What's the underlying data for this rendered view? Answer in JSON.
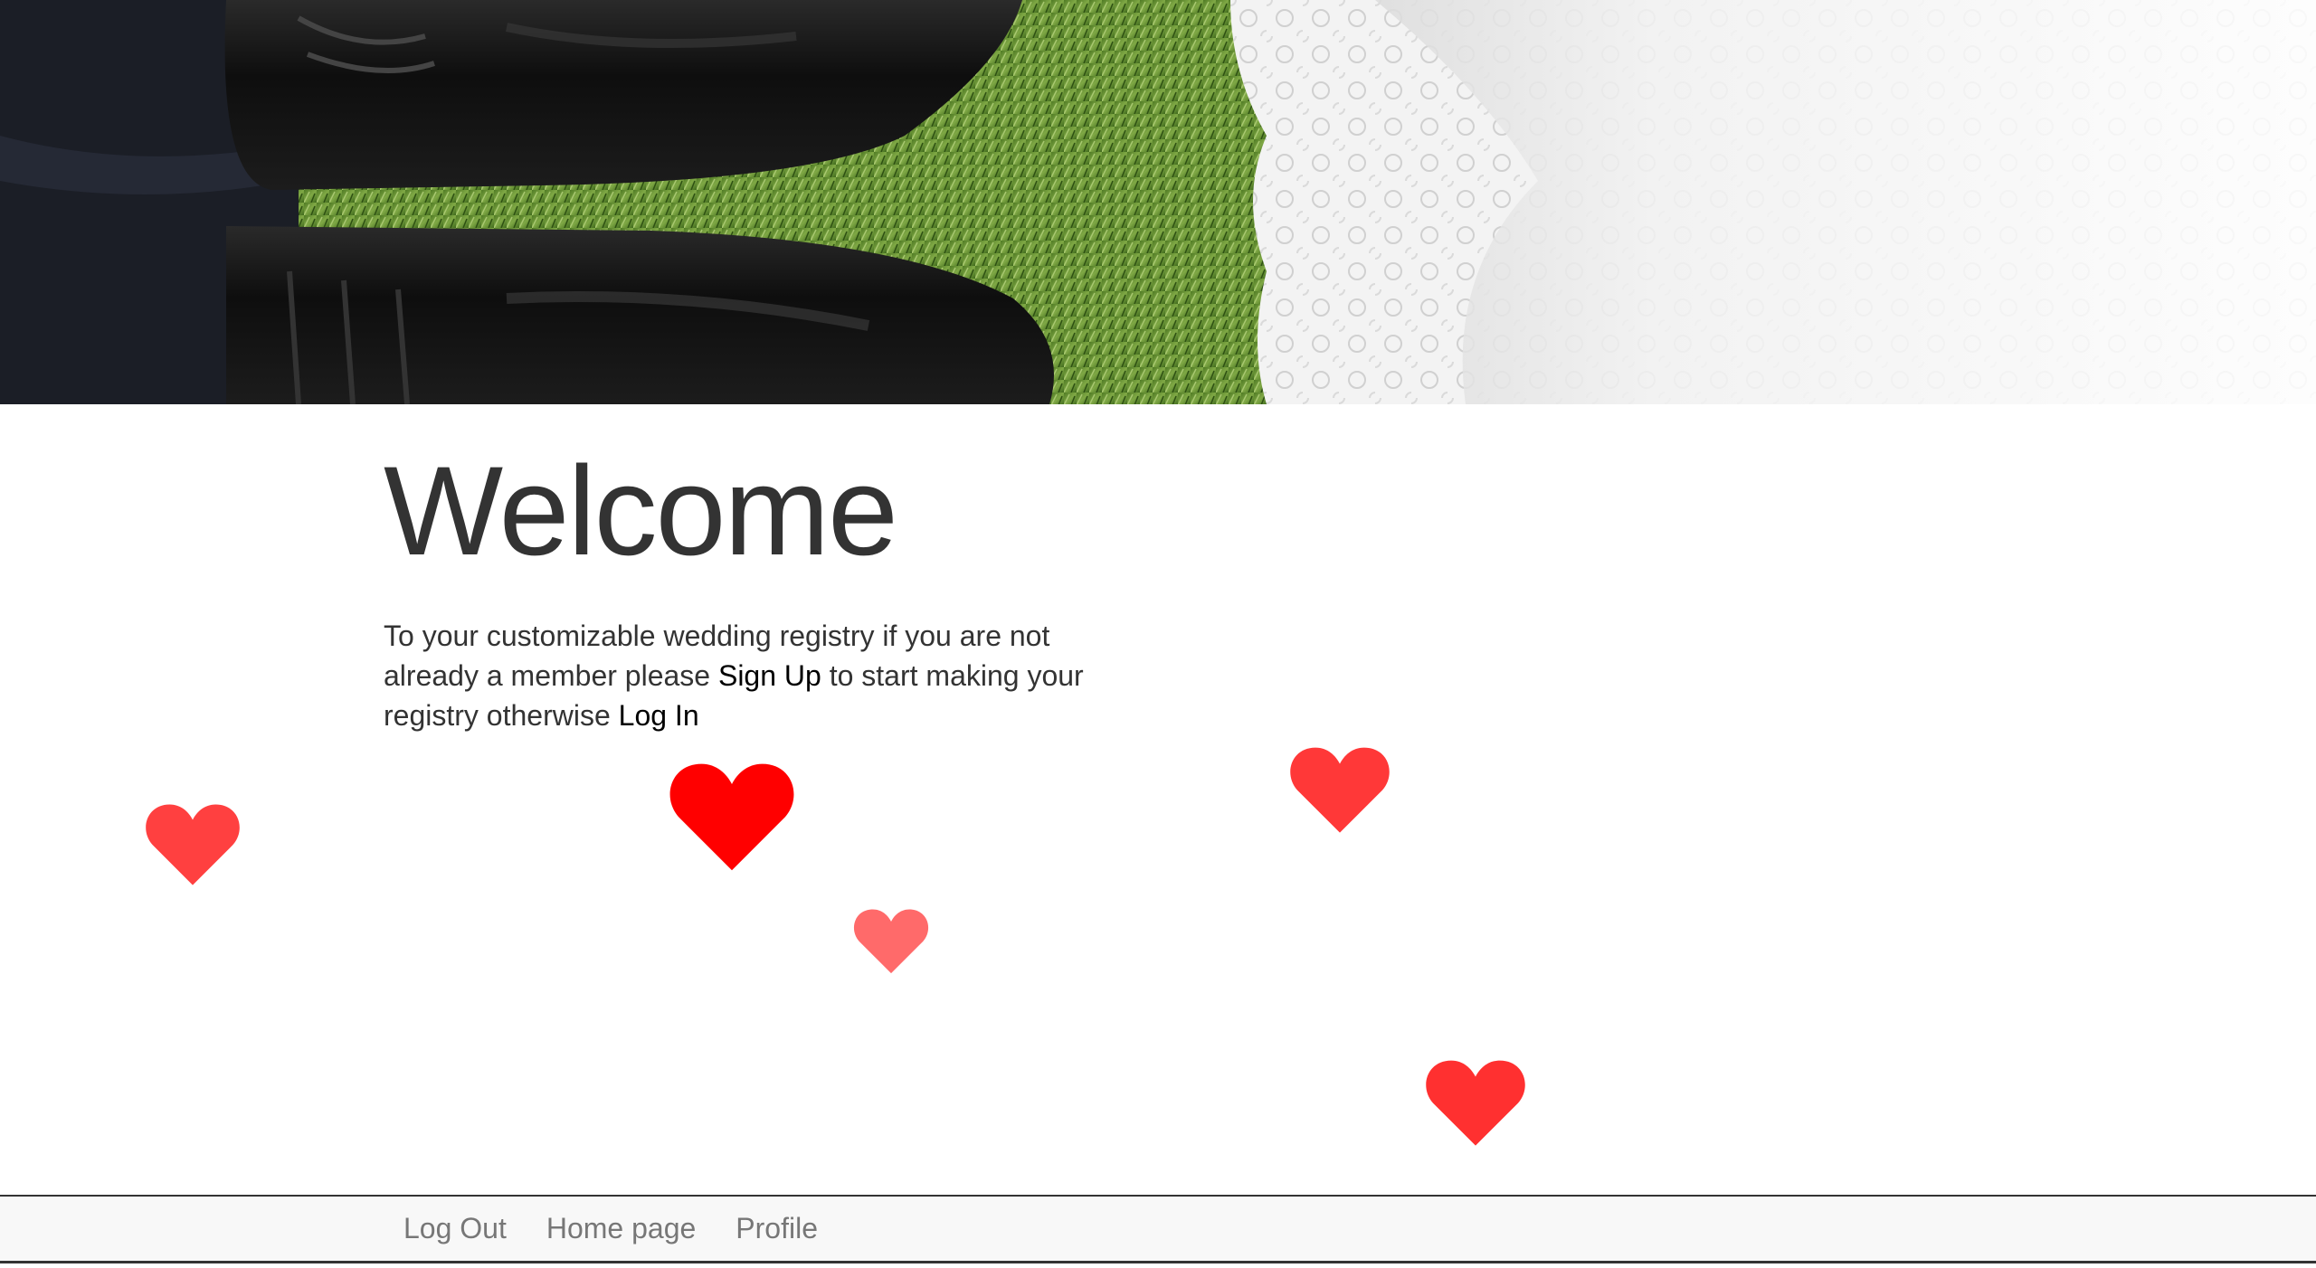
{
  "hero": {
    "image_alt": "Groom's black dress shoes on grass beside bride's white lace dress"
  },
  "main": {
    "title": "Welcome",
    "intro_part1": "To your customizable wedding registry if you are not already a member please ",
    "signup_link": "Sign Up",
    "intro_part2": " to start making your registry otherwise ",
    "login_link": "Log In"
  },
  "hearts": [
    {
      "name": "heart-icon",
      "color": "#ff4040"
    },
    {
      "name": "heart-icon",
      "color": "#ff0000"
    },
    {
      "name": "heart-icon",
      "color": "#ff6a6a"
    },
    {
      "name": "heart-icon",
      "color": "#ff3838"
    },
    {
      "name": "heart-icon",
      "color": "#ff3030"
    }
  ],
  "nav": {
    "items": [
      {
        "label": "Log Out"
      },
      {
        "label": "Home page"
      },
      {
        "label": "Profile"
      }
    ]
  },
  "colors": {
    "text": "#333333",
    "link": "#000000",
    "nav_text": "#777777",
    "nav_bg": "#f8f8f8"
  }
}
